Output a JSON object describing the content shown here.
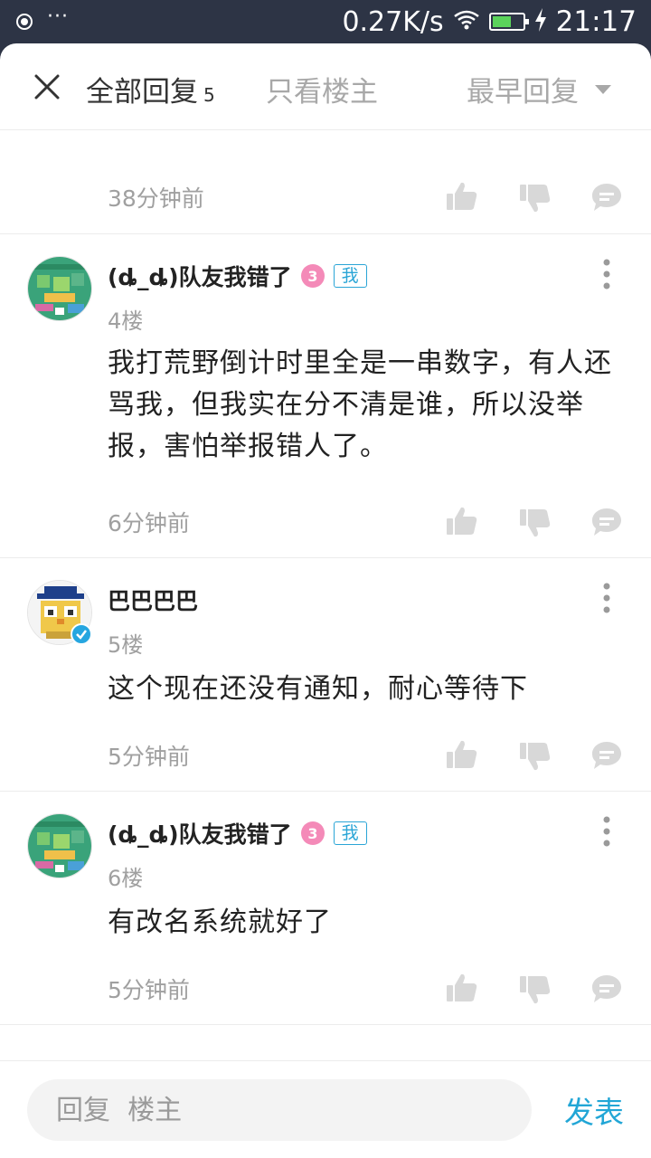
{
  "status_bar": {
    "net_speed": "0.27K/s",
    "time": "21:17",
    "battery_level": 0.65
  },
  "header": {
    "tab_all_label": "全部回复",
    "tab_all_count": "5",
    "tab_owner_label": "只看楼主",
    "sort_label": "最早回复"
  },
  "top_block": {
    "time": "38分钟前"
  },
  "comments": [
    {
      "username": "(ȡ_ȡ)队友我错了",
      "me_badge": "我",
      "floor": "4楼",
      "text": "我打荒野倒计时里全是一串数字，有人还骂我，但我实在分不清是谁，所以没举报，害怕举报错人了。",
      "time": "6分钟前"
    },
    {
      "username": "巴巴巴巴",
      "floor": "5楼",
      "text": "这个现在还没有通知，耐心等待下",
      "time": "5分钟前"
    },
    {
      "username": "(ȡ_ȡ)队友我错了",
      "me_badge": "我",
      "floor": "6楼",
      "text": "有改名系统就好了",
      "time": "5分钟前"
    }
  ],
  "footer": {
    "reply_placeholder": "回复  楼主",
    "send_label": "发表"
  },
  "colors": {
    "accent": "#22a6d6",
    "status_bar_bg": "#2d3445",
    "muted_text": "#a0a0a0"
  }
}
